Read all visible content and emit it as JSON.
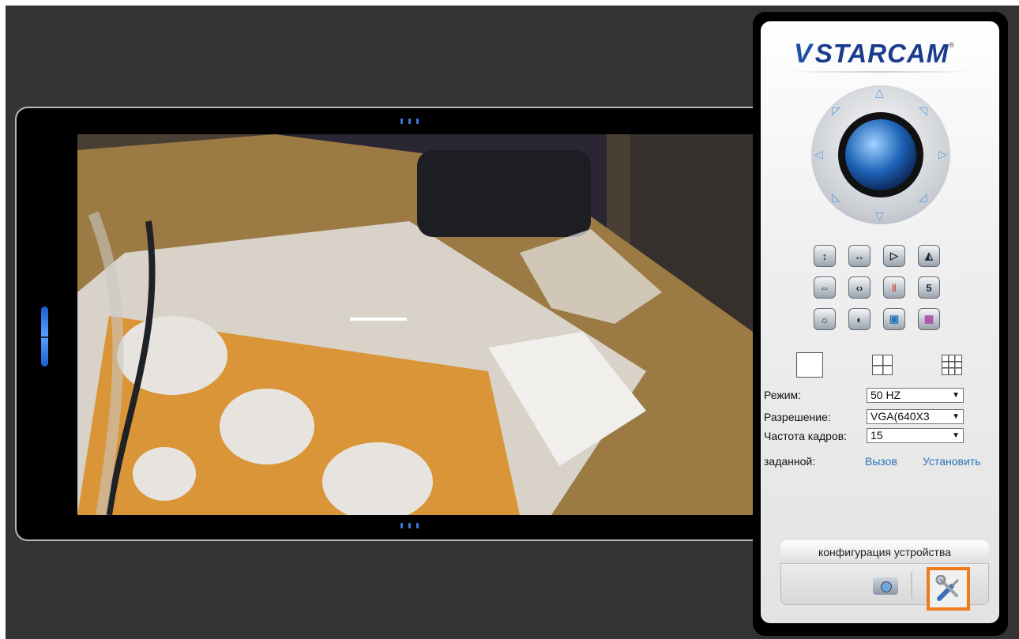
{
  "brand": {
    "mark": "V",
    "name": "STARCAM",
    "reg": "®"
  },
  "panel_buttons": [
    {
      "icon": "vertical-flip-icon",
      "glyph": "↕"
    },
    {
      "icon": "horizontal-flip-icon",
      "glyph": "↔"
    },
    {
      "icon": "play-icon",
      "glyph": "▷"
    },
    {
      "icon": "mirror-icon",
      "glyph": "◭"
    },
    {
      "icon": "vertical-patrol-icon",
      "glyph": "⇔"
    },
    {
      "icon": "horizontal-patrol-icon",
      "glyph": "‹›"
    },
    {
      "icon": "patrol-stop-icon",
      "glyph": "‖"
    },
    {
      "icon": "number-five-icon",
      "glyph": "5"
    },
    {
      "icon": "brightness-icon",
      "glyph": "☼"
    },
    {
      "icon": "contrast-icon",
      "glyph": "◐"
    },
    {
      "icon": "window-icon",
      "glyph": "▣"
    },
    {
      "icon": "color-palette-icon",
      "glyph": "▦"
    }
  ],
  "settings": {
    "mode_label": "Режим:",
    "mode_value": "50 HZ",
    "resolution_label": "Разрешение:",
    "resolution_value": "VGA(640X3",
    "framerate_label": "Частота кадров:",
    "framerate_value": "15",
    "preset_label": "заданной:",
    "call_link": "Вызов",
    "set_link": "Установить"
  },
  "config": {
    "tab_label": "конфигурация устройства"
  },
  "colors": {
    "accent": "#f07a1a",
    "link": "#2a74b9",
    "brand": "#1a3c8c"
  }
}
